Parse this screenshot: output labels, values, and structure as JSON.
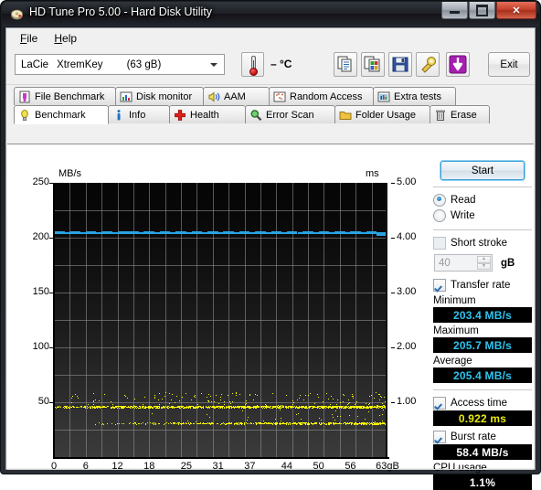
{
  "window": {
    "title": "HD Tune Pro 5.00 - Hard Disk Utility",
    "icon": "hdtune-logo-icon",
    "buttons": {
      "minimize": "minimize",
      "maximize": "maximize",
      "close": "✕"
    }
  },
  "menu": {
    "items": [
      "File",
      "Help"
    ]
  },
  "toolbar": {
    "drive": {
      "vendor": "LaCie",
      "model": "XtremKey",
      "capacity": "(63 gB)"
    },
    "temperature": "– °C",
    "buttons": [
      {
        "name": "copy-text-button",
        "icon": "copy-document-icon"
      },
      {
        "name": "copy-image-button",
        "icon": "copy-image-icon"
      },
      {
        "name": "save-button",
        "icon": "floppy-disk-icon"
      },
      {
        "name": "options-button",
        "icon": "wrench-icon"
      },
      {
        "name": "download-button",
        "icon": "purple-down-arrow-icon"
      }
    ],
    "exit_label": "Exit"
  },
  "tabs": {
    "row1": [
      {
        "label": "File Benchmark",
        "icon": "file-benchmark-icon",
        "active": false
      },
      {
        "label": "Disk monitor",
        "icon": "bar-chart-icon",
        "active": false
      },
      {
        "label": "AAM",
        "icon": "speaker-icon",
        "active": false
      },
      {
        "label": "Random Access",
        "icon": "scatter-icon",
        "active": false
      },
      {
        "label": "Extra tests",
        "icon": "chart-grid-icon",
        "active": false
      }
    ],
    "row2": [
      {
        "label": "Benchmark",
        "icon": "bulb-icon",
        "active": true
      },
      {
        "label": "Info",
        "icon": "info-icon",
        "active": false
      },
      {
        "label": "Health",
        "icon": "red-cross-icon",
        "active": false
      },
      {
        "label": "Error Scan",
        "icon": "magnifier-icon",
        "active": false
      },
      {
        "label": "Folder Usage",
        "icon": "folder-icon",
        "active": false
      },
      {
        "label": "Erase",
        "icon": "trash-icon",
        "active": false
      }
    ]
  },
  "side": {
    "start_label": "Start",
    "mode": [
      {
        "label": "Read",
        "selected": true
      },
      {
        "label": "Write",
        "selected": false
      }
    ],
    "short_stroke": {
      "label": "Short stroke",
      "checked": false,
      "value": "40",
      "unit": "gB"
    },
    "transfer_rate": {
      "label": "Transfer rate",
      "checked": true
    },
    "minimum": {
      "label": "Minimum",
      "value": "203.4 MB/s"
    },
    "maximum": {
      "label": "Maximum",
      "value": "205.7 MB/s"
    },
    "average": {
      "label": "Average",
      "value": "205.4 MB/s"
    },
    "access_time": {
      "label": "Access time",
      "checked": true,
      "value": "0.922 ms"
    },
    "burst_rate": {
      "label": "Burst rate",
      "checked": true,
      "value": "58.4 MB/s"
    },
    "cpu_usage": {
      "label": "CPU usage",
      "value": "1.1%"
    }
  },
  "chart_data": {
    "type": "line",
    "title": "",
    "xlabel": "gB",
    "ylabel": "MB/s",
    "y2label": "ms",
    "xlim": [
      0,
      63
    ],
    "ylim": [
      0,
      250
    ],
    "y2lim": [
      0,
      5.0
    ],
    "grid": true,
    "legend": "none",
    "xticks": [
      "0",
      "6",
      "12",
      "18",
      "25",
      "31",
      "37",
      "44",
      "50",
      "56",
      "63gB"
    ],
    "xtick_values": [
      0,
      6,
      12,
      18,
      25,
      31,
      37,
      44,
      50,
      56,
      63
    ],
    "yticks": [
      "250",
      "200",
      "150",
      "100",
      "50"
    ],
    "ytick_values": [
      250,
      200,
      150,
      100,
      50
    ],
    "y2ticks": [
      "5.00",
      "4.00",
      "3.00",
      "2.00",
      "1.00"
    ],
    "y2tick_values": [
      5.0,
      4.0,
      3.0,
      2.0,
      1.0
    ],
    "series": [
      {
        "name": "Transfer rate",
        "type": "line",
        "color": "#2aa3e0",
        "axis": "left",
        "unit": "MB/s",
        "minimum": 203.4,
        "maximum": 205.7,
        "average": 205.4,
        "x": [
          0,
          1,
          2,
          3,
          4,
          5,
          6,
          7,
          8,
          9,
          10,
          11,
          12,
          13,
          14,
          15,
          16,
          17,
          18,
          19,
          20,
          21,
          22,
          23,
          24,
          25,
          26,
          27,
          28,
          29,
          30,
          31,
          32,
          33,
          34,
          35,
          36,
          37,
          38,
          39,
          40,
          41,
          42,
          43,
          44,
          45,
          46,
          47,
          48,
          49,
          50,
          51,
          52,
          53,
          54,
          55,
          56,
          57,
          58,
          59,
          60,
          61,
          62,
          63
        ],
        "values": [
          205.4,
          205.5,
          205.4,
          205.3,
          205.5,
          205.4,
          205.4,
          205.6,
          205.3,
          205.4,
          205.7,
          205.4,
          205.3,
          205.5,
          205.4,
          205.6,
          205.4,
          205.3,
          205.5,
          205.4,
          205.4,
          205.6,
          205.3,
          205.4,
          205.5,
          205.4,
          205.4,
          205.7,
          205.3,
          205.4,
          205.5,
          205.4,
          205.3,
          205.6,
          205.4,
          205.4,
          205.5,
          205.3,
          205.4,
          205.6,
          205.4,
          205.4,
          205.5,
          205.3,
          205.4,
          205.6,
          205.4,
          205.3,
          205.5,
          205.4,
          205.4,
          205.6,
          205.3,
          205.4,
          205.5,
          205.4,
          205.4,
          205.5,
          205.3,
          205.4,
          205.6,
          205.4,
          203.4,
          205.4
        ]
      },
      {
        "name": "Access time",
        "type": "scatter",
        "color": "#ffff00",
        "axis": "right",
        "unit": "ms",
        "average": 0.922,
        "band_upper_ms": 0.92,
        "band_lower_ms": 0.62,
        "note": "Dense scatter of yellow access-time samples forming two horizontal bands across the full capacity range; upper band at ~0.92 ms thins toward the right, lower band at ~0.62 ms sparse after ~20 gB."
      }
    ]
  }
}
